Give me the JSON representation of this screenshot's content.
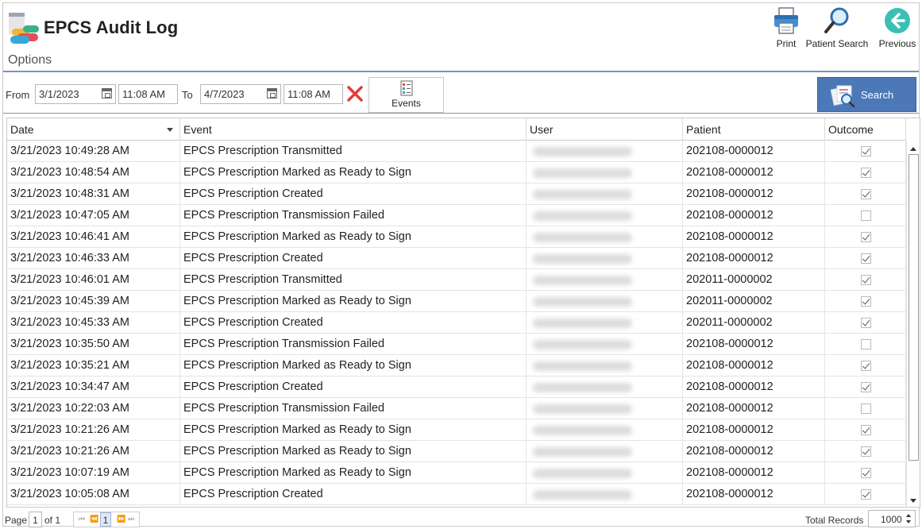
{
  "app": {
    "title": "EPCS Audit Log",
    "options_label": "Options"
  },
  "toolbar": {
    "print_label": "Print",
    "patient_search_label": "Patient Search",
    "previous_label": "Previous"
  },
  "filter": {
    "from_label": "From",
    "from_date": "3/1/2023",
    "from_time": "11:08 AM",
    "to_label": "To",
    "to_date": "4/7/2023",
    "to_time": "11:08 AM",
    "events_label": "Events",
    "search_label": "Search"
  },
  "grid": {
    "columns": {
      "date": "Date",
      "event": "Event",
      "user": "User",
      "patient": "Patient",
      "outcome": "Outcome"
    },
    "rows": [
      {
        "date": "3/21/2023 10:49:28 AM",
        "event": "EPCS Prescription Transmitted",
        "patient": "202108-0000012",
        "outcome": true
      },
      {
        "date": "3/21/2023 10:48:54 AM",
        "event": "EPCS Prescription Marked as Ready to Sign",
        "patient": "202108-0000012",
        "outcome": true
      },
      {
        "date": "3/21/2023 10:48:31 AM",
        "event": "EPCS Prescription Created",
        "patient": "202108-0000012",
        "outcome": true
      },
      {
        "date": "3/21/2023 10:47:05 AM",
        "event": "EPCS Prescription Transmission Failed",
        "patient": "202108-0000012",
        "outcome": false
      },
      {
        "date": "3/21/2023 10:46:41 AM",
        "event": "EPCS Prescription Marked as Ready to Sign",
        "patient": "202108-0000012",
        "outcome": true
      },
      {
        "date": "3/21/2023 10:46:33 AM",
        "event": "EPCS Prescription Created",
        "patient": "202108-0000012",
        "outcome": true
      },
      {
        "date": "3/21/2023 10:46:01 AM",
        "event": "EPCS Prescription Transmitted",
        "patient": "202011-0000002",
        "outcome": true
      },
      {
        "date": "3/21/2023 10:45:39 AM",
        "event": "EPCS Prescription Marked as Ready to Sign",
        "patient": "202011-0000002",
        "outcome": true
      },
      {
        "date": "3/21/2023 10:45:33 AM",
        "event": "EPCS Prescription Created",
        "patient": "202011-0000002",
        "outcome": true
      },
      {
        "date": "3/21/2023 10:35:50 AM",
        "event": "EPCS Prescription Transmission Failed",
        "patient": "202108-0000012",
        "outcome": false
      },
      {
        "date": "3/21/2023 10:35:21 AM",
        "event": "EPCS Prescription Marked as Ready to Sign",
        "patient": "202108-0000012",
        "outcome": true
      },
      {
        "date": "3/21/2023 10:34:47 AM",
        "event": "EPCS Prescription Created",
        "patient": "202108-0000012",
        "outcome": true
      },
      {
        "date": "3/21/2023 10:22:03 AM",
        "event": "EPCS Prescription Transmission Failed",
        "patient": "202108-0000012",
        "outcome": false
      },
      {
        "date": "3/21/2023 10:21:26 AM",
        "event": "EPCS Prescription Marked as Ready to Sign",
        "patient": "202108-0000012",
        "outcome": true
      },
      {
        "date": "3/21/2023 10:21:26 AM",
        "event": "EPCS Prescription Marked as Ready to Sign",
        "patient": "202108-0000012",
        "outcome": true
      },
      {
        "date": "3/21/2023 10:07:19 AM",
        "event": "EPCS Prescription Marked as Ready to Sign",
        "patient": "202108-0000012",
        "outcome": true
      },
      {
        "date": "3/21/2023 10:05:08 AM",
        "event": "EPCS Prescription Created",
        "patient": "202108-0000012",
        "outcome": true
      }
    ]
  },
  "footer": {
    "page_label": "Page",
    "page_value": "1",
    "of_label": "of 1",
    "current_page": "1",
    "total_records_label": "Total Records",
    "total_records_value": "1000"
  },
  "colors": {
    "accent": "#4c78b8",
    "rule": "#7f93b8",
    "clear": "#e23b3b"
  }
}
